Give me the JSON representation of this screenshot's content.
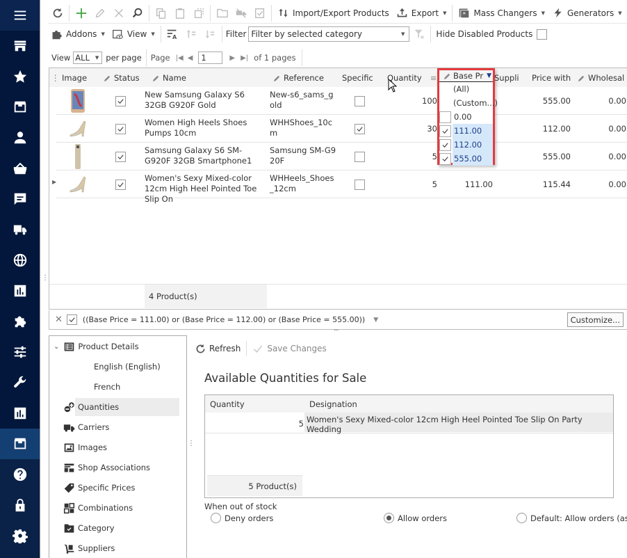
{
  "nav": {
    "items": [
      {
        "icon": "menu-icon"
      },
      {
        "icon": "store-icon"
      },
      {
        "icon": "star-icon"
      },
      {
        "icon": "archive-icon"
      },
      {
        "icon": "user-icon"
      },
      {
        "icon": "basket-icon"
      },
      {
        "icon": "message-icon"
      },
      {
        "icon": "truck-icon"
      },
      {
        "icon": "globe-icon"
      },
      {
        "icon": "bar-chart-icon"
      },
      {
        "icon": "puzzle-icon"
      },
      {
        "icon": "sliders-icon"
      },
      {
        "icon": "wrench-icon"
      },
      {
        "icon": "report-icon"
      },
      {
        "icon": "archive-icon",
        "active": true
      },
      {
        "icon": "help-icon"
      },
      {
        "icon": "lock-icon"
      },
      {
        "icon": "gear-icon"
      }
    ]
  },
  "toolbar": {
    "import_export": "Import/Export Products",
    "export": "Export",
    "mass_changers": "Mass Changers",
    "generators": "Generators",
    "addons": "Addons",
    "view": "View",
    "filter_label": "Filter",
    "filter_value": "Filter by selected category",
    "hide_disabled": "Hide Disabled Products",
    "hide_disabled_checked": false
  },
  "pager": {
    "view_label": "View",
    "per_page_value": "ALL",
    "per_page_label": "per page",
    "page_label": "Page",
    "page_value": "1",
    "of_pages": "of 1 pages"
  },
  "grid": {
    "columns": [
      "Image",
      "Status",
      "Name",
      "Reference",
      "Specific",
      "Quantity",
      "Base Pr",
      "Suppli",
      "Price with",
      "Wholesal"
    ],
    "rows": [
      {
        "image": "phone-gold",
        "status": true,
        "name": "New Samsung Galaxy S6 32GB G920F Gold",
        "reference": "New-s6_sams_gold",
        "specific": false,
        "quantity": "100",
        "base_price": "",
        "price_with": "555.00",
        "wholesale": "0.00"
      },
      {
        "image": "heels",
        "status": true,
        "name": "Women High Heels Shoes Pumps 10cm",
        "reference": "WHHShoes_10cm",
        "specific": true,
        "quantity": "30",
        "base_price": "",
        "price_with": "112.00",
        "wholesale": "0.00"
      },
      {
        "image": "phone-side",
        "status": true,
        "name": "Samsung Galaxy S6 SM-G920F 32GB Smartphone1",
        "reference": "Samsung SM-G920F",
        "specific": false,
        "quantity": "5",
        "base_price": "",
        "price_with": "555.00",
        "wholesale": "0.00"
      },
      {
        "image": "heels",
        "status": true,
        "name": "Women's Sexy Mixed-color 12cm High Heel Pointed Toe Slip On",
        "reference": "WHHeels_Shoes_12cm",
        "specific": false,
        "quantity": "5",
        "base_price": "111.00",
        "price_with": "115.44",
        "wholesale": "0.00",
        "current": true
      }
    ],
    "summary": "4 Product(s)"
  },
  "filter_dropdown": {
    "header": "Base Pr",
    "items": [
      {
        "label": "(All)",
        "checkbox": false
      },
      {
        "label": "(Custom...)",
        "checkbox": false
      },
      {
        "label": "0.00",
        "checkbox": true,
        "checked": false
      },
      {
        "label": "111.00",
        "checkbox": true,
        "checked": true
      },
      {
        "label": "112.00",
        "checkbox": true,
        "checked": true
      },
      {
        "label": "555.00",
        "checkbox": true,
        "checked": true
      }
    ]
  },
  "filter_bar": {
    "enabled": true,
    "expression": "((Base Price = 111.00) or (Base Price = 112.00) or (Base Price = 555.00))",
    "customize": "Customize..."
  },
  "tree": {
    "items": [
      {
        "label": "Product Details",
        "icon": "details-icon",
        "expanded": true
      },
      {
        "label": "English (English)",
        "child": true
      },
      {
        "label": "French",
        "child": true
      },
      {
        "label": "Quantities",
        "icon": "quantities-icon",
        "selected": true
      },
      {
        "label": "Carriers",
        "icon": "truck-icon"
      },
      {
        "label": "Images",
        "icon": "image-icon"
      },
      {
        "label": "Shop Associations",
        "icon": "shop-assoc-icon"
      },
      {
        "label": "Specific Prices",
        "icon": "tag-icon"
      },
      {
        "label": "Combinations",
        "icon": "combinations-icon"
      },
      {
        "label": "Category",
        "icon": "category-icon"
      },
      {
        "label": "Suppliers",
        "icon": "suppliers-icon"
      }
    ]
  },
  "detail": {
    "refresh": "Refresh",
    "save": "Save Changes",
    "title": "Available Quantities for Sale",
    "table": {
      "columns": [
        "Quantity",
        "Designation"
      ],
      "rows": [
        {
          "quantity": "5",
          "designation": "Women's Sexy Mixed-color 12cm High Heel Pointed Toe Slip On Party Wedding"
        }
      ],
      "summary": "5 Product(s)"
    },
    "out_of_stock_label": "When out of stock",
    "options": [
      {
        "label": "Deny orders",
        "selected": false
      },
      {
        "label": "Allow orders",
        "selected": true
      },
      {
        "label": "Default: Allow orders (as set in Pr",
        "selected": false
      }
    ]
  }
}
